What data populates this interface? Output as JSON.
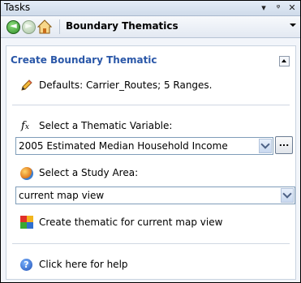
{
  "panel": {
    "title": "Tasks",
    "title_buttons": [
      "▾",
      "ᵠ",
      "✕"
    ]
  },
  "nav": {
    "back_glyph": "◄",
    "forward_glyph": "►",
    "title": "Boundary Thematics"
  },
  "section": {
    "title": "Create Boundary Thematic",
    "defaults": "Defaults: Carrier_Routes; 5 Ranges.",
    "variable_label": "Select a Thematic Variable:",
    "variable_value": "2005 Estimated Median Household Income",
    "more_label": "...",
    "study_area_label": "Select a Study Area:",
    "study_area_value": "current map view",
    "create_label": "Create thematic for current map view",
    "help_label": "Click here for help"
  },
  "icons": {
    "back": "back-arrow-icon",
    "forward": "forward-arrow-icon",
    "home": "home-icon",
    "pencil": "pencil-icon",
    "fx": "function-icon",
    "globe": "globe-icon",
    "map": "thematic-map-icon",
    "help": "help-icon"
  }
}
